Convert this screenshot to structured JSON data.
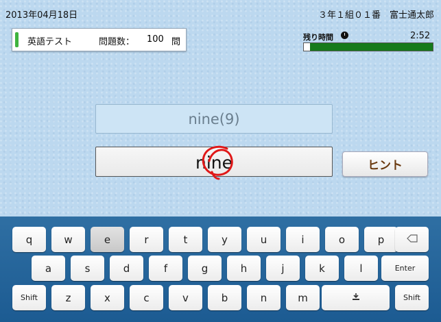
{
  "header": {
    "date": "2013年04月18日",
    "student": "３年１組０１番　富士通太郎"
  },
  "test_info": {
    "title": "英語テスト",
    "count_label": "問題数：",
    "count": "100",
    "unit": "問"
  },
  "timer": {
    "label": "残り時間",
    "icon": "clock-icon",
    "value": "2:52",
    "remaining_fraction": 0.95
  },
  "question": {
    "prompt": "nine(9)",
    "answer": "nine"
  },
  "hint_button": {
    "label": "ヒント"
  },
  "keyboard": {
    "row1": [
      "q",
      "w",
      "e",
      "r",
      "t",
      "y",
      "u",
      "i",
      "o",
      "p"
    ],
    "row2": [
      "a",
      "s",
      "d",
      "f",
      "g",
      "h",
      "j",
      "k",
      "l"
    ],
    "row3": [
      "z",
      "x",
      "c",
      "v",
      "b",
      "n",
      "m"
    ],
    "backspace_icon": "backspace-icon",
    "enter_label": "Enter",
    "shift_label": "Shift",
    "hide_keyboard_icon": "hide-keyboard-icon",
    "active_key": "e"
  },
  "colors": {
    "accent_green": "#3fb43f",
    "timer_green": "#167a1b",
    "correct_mark": "#e01818",
    "hint_text": "#6a3a10"
  }
}
